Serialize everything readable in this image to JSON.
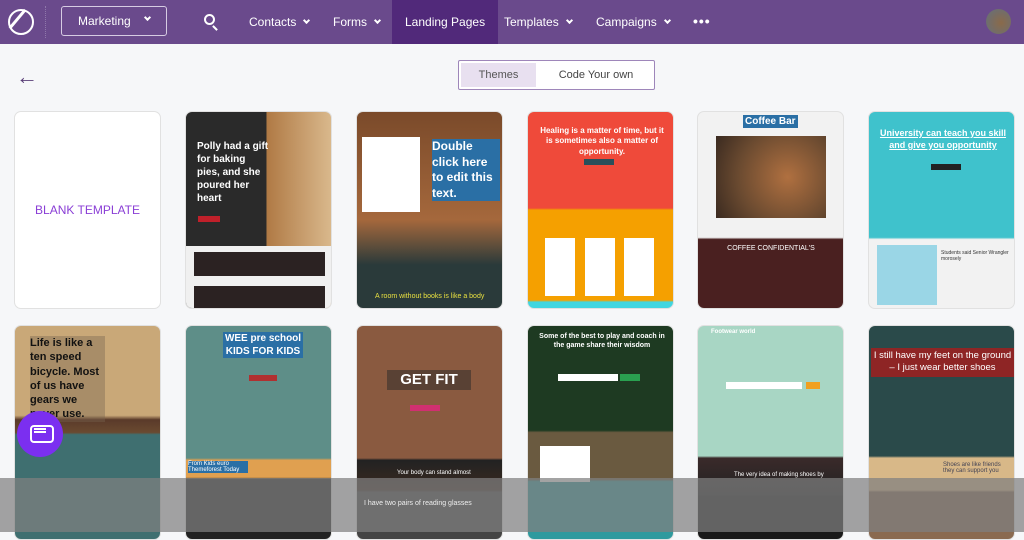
{
  "nav": {
    "workspace": "Marketing",
    "items": [
      {
        "label": "Contacts"
      },
      {
        "label": "Forms"
      },
      {
        "label": "Landing Pages",
        "active": true
      },
      {
        "label": "Templates"
      },
      {
        "label": "Campaigns"
      }
    ],
    "more": "•••"
  },
  "tabs": {
    "themes": "Themes",
    "code": "Code Your own",
    "selected": "Themes"
  },
  "colors": {
    "nav": "#6a4a8c",
    "active": "#51297a",
    "accent": "#8a3ed6"
  },
  "cards": [
    {
      "title": "BLANK TEMPLATE"
    },
    {
      "title": "Polly had a gift for baking pies, and she poured her heart"
    },
    {
      "title": "Double click here to edit this text.",
      "footer": "A room without books is like a body"
    },
    {
      "title": "Healing is a matter of time, but it is sometimes also a matter of opportunity."
    },
    {
      "title": "Coffee Bar",
      "footer": "COFFEE CONFIDENTIAL'S"
    },
    {
      "title": "University can teach you skill and give you opportunity",
      "footer": "Students said Senior Wrangler morosely"
    },
    {
      "title": "Life is like a ten speed bicycle. Most of us have gears we never use."
    },
    {
      "title": "WEE pre school KIDS FOR KIDS",
      "footer": "From Kids euro Themeforest Today"
    },
    {
      "title": "GET FIT",
      "footer": "Your body can stand almost",
      "footer2": "I have two pairs of reading glasses"
    },
    {
      "title": "Some of the best to play and coach in the game share their wisdom"
    },
    {
      "title": "Footwear world",
      "footer": "The very idea of making shoes by"
    },
    {
      "title": "I still have my feet on the ground – I just wear better shoes",
      "footer": "Shoes are like friends they can support you"
    }
  ]
}
